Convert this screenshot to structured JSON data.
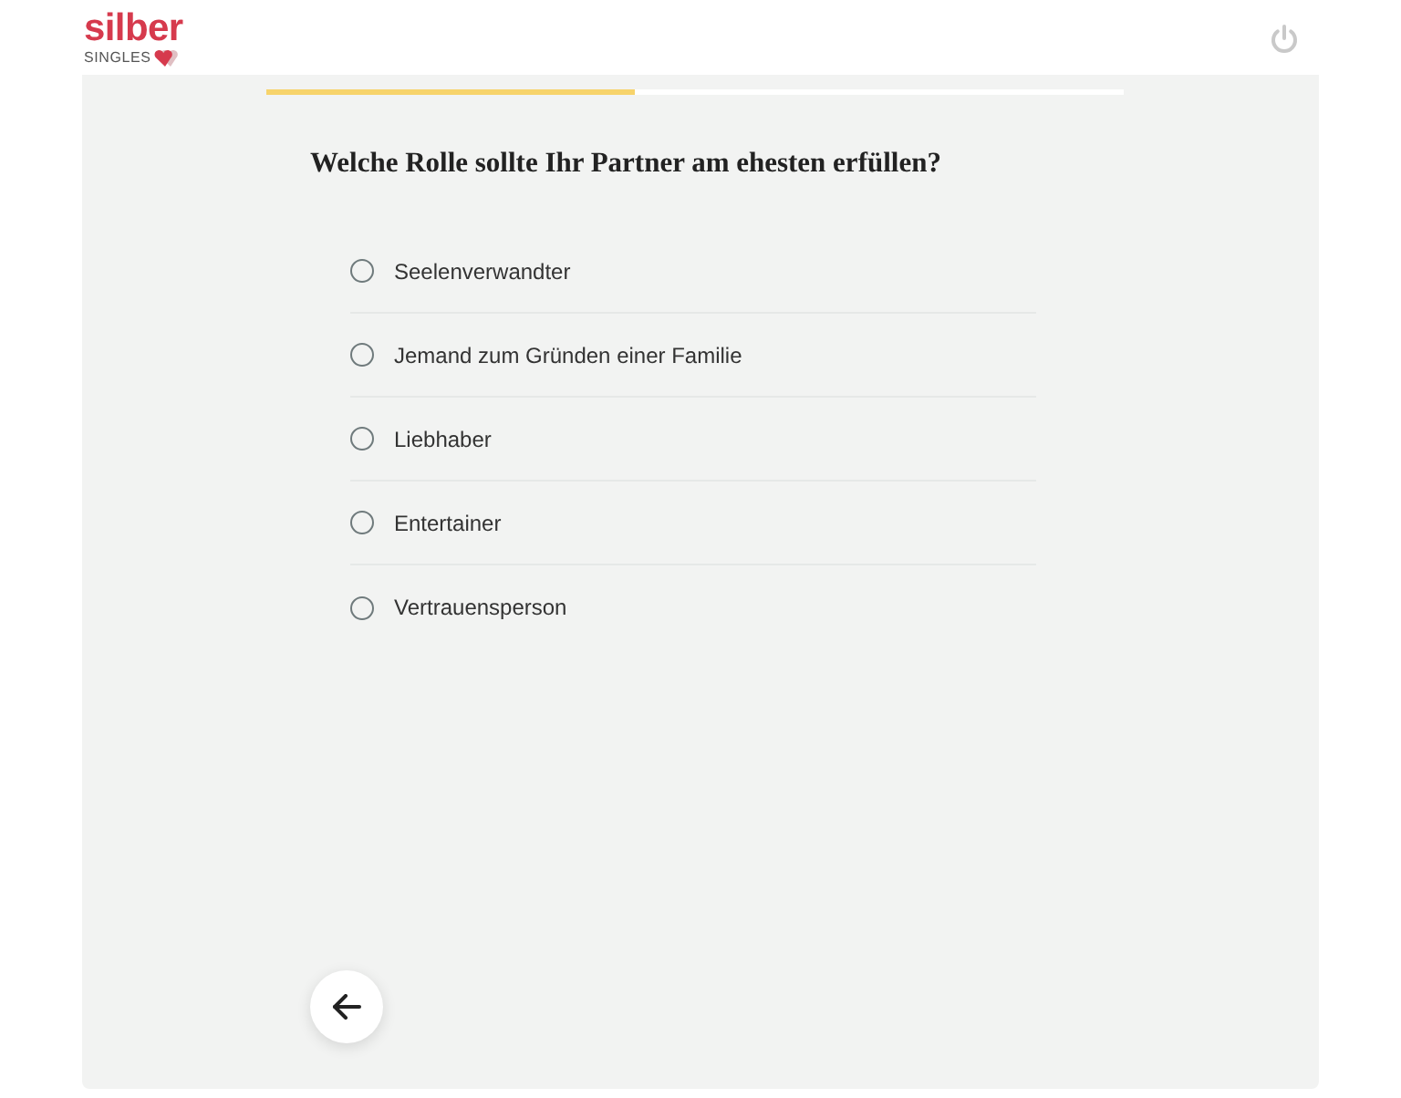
{
  "header": {
    "logo": {
      "name": "silber",
      "tagline": "SINGLES"
    }
  },
  "progress": {
    "level": 0.43
  },
  "question": "Welche Rolle sollte Ihr Partner am ehesten erfüllen?",
  "options": [
    {
      "label": "Seelenverwandter",
      "selected": false
    },
    {
      "label": "Jemand zum Gründen einer Familie",
      "selected": false
    },
    {
      "label": "Liebhaber",
      "selected": false
    },
    {
      "label": "Entertainer",
      "selected": false
    },
    {
      "label": "Vertrauensperson",
      "selected": false
    }
  ]
}
